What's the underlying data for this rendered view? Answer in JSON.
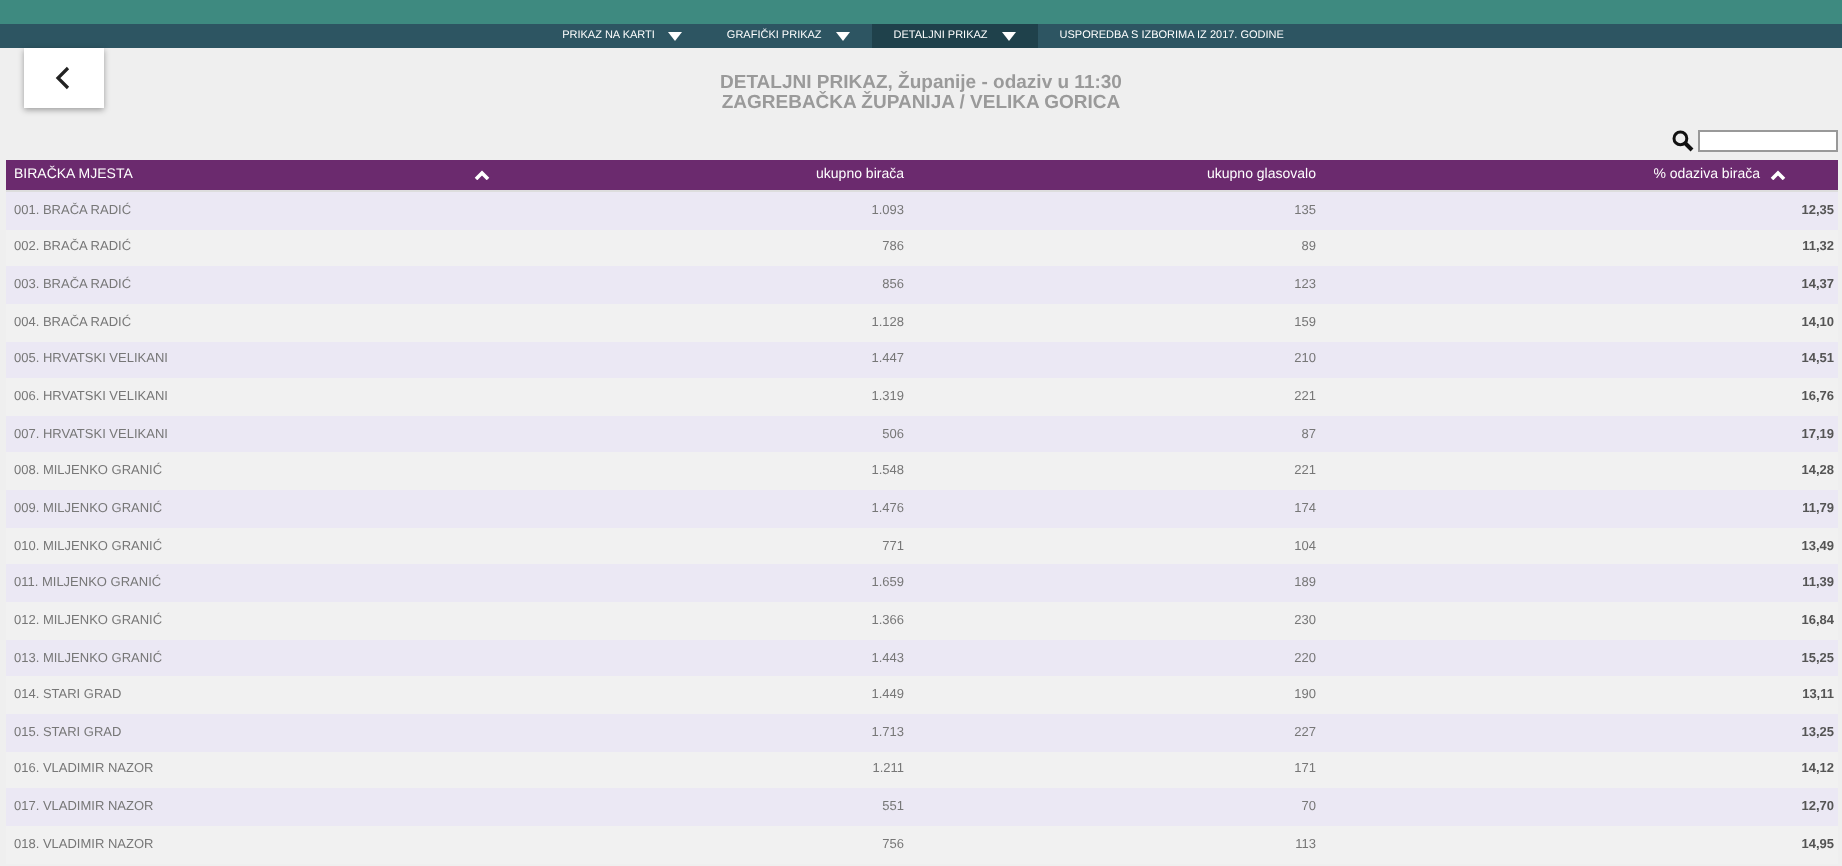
{
  "nav": {
    "tabs": [
      {
        "label": "PRIKAZ NA KARTI",
        "dropdown": true,
        "selected": false
      },
      {
        "label": "GRAFIČKI PRIKAZ",
        "dropdown": true,
        "selected": false
      },
      {
        "label": "DETALJNI PRIKAZ",
        "dropdown": true,
        "selected": true
      },
      {
        "label": "USPOREDBA S IZBORIMA IZ 2017. GODINE",
        "dropdown": false,
        "selected": false
      }
    ]
  },
  "title": {
    "line_1": "DETALJNI PRIKAZ, Županije - odaziv u 11:30",
    "line_2": "ZAGREBAČKA ŽUPANIJA / VELIKA GORICA"
  },
  "table": {
    "columns": [
      {
        "label": "BIRAČKA MJESTA",
        "sort_icon": true
      },
      {
        "label": "ukupno birača",
        "sort_icon": false
      },
      {
        "label": "ukupno glasovalo",
        "sort_icon": false
      },
      {
        "label": "% odaziva birača",
        "sort_icon": true
      }
    ],
    "rows": [
      [
        "001. BRAČA RADIĆ",
        "1.093",
        "135",
        "12,35"
      ],
      [
        "002. BRAČA RADIĆ",
        "786",
        "89",
        "11,32"
      ],
      [
        "003. BRAČA RADIĆ",
        "856",
        "123",
        "14,37"
      ],
      [
        "004. BRAČA RADIĆ",
        "1.128",
        "159",
        "14,10"
      ],
      [
        "005. HRVATSKI VELIKANI",
        "1.447",
        "210",
        "14,51"
      ],
      [
        "006. HRVATSKI VELIKANI",
        "1.319",
        "221",
        "16,76"
      ],
      [
        "007. HRVATSKI VELIKANI",
        "506",
        "87",
        "17,19"
      ],
      [
        "008. MILJENKO GRANIĆ",
        "1.548",
        "221",
        "14,28"
      ],
      [
        "009. MILJENKO GRANIĆ",
        "1.476",
        "174",
        "11,79"
      ],
      [
        "010. MILJENKO GRANIĆ",
        "771",
        "104",
        "13,49"
      ],
      [
        "011. MILJENKO GRANIĆ",
        "1.659",
        "189",
        "11,39"
      ],
      [
        "012. MILJENKO GRANIĆ",
        "1.366",
        "230",
        "16,84"
      ],
      [
        "013. MILJENKO GRANIĆ",
        "1.443",
        "220",
        "15,25"
      ],
      [
        "014. STARI GRAD",
        "1.449",
        "190",
        "13,11"
      ],
      [
        "015. STARI GRAD",
        "1.713",
        "227",
        "13,25"
      ],
      [
        "016. VLADIMIR NAZOR",
        "1.211",
        "171",
        "14,12"
      ],
      [
        "017. VLADIMIR NAZOR",
        "551",
        "70",
        "12,70"
      ],
      [
        "018. VLADIMIR NAZOR",
        "756",
        "113",
        "14,95"
      ]
    ]
  }
}
